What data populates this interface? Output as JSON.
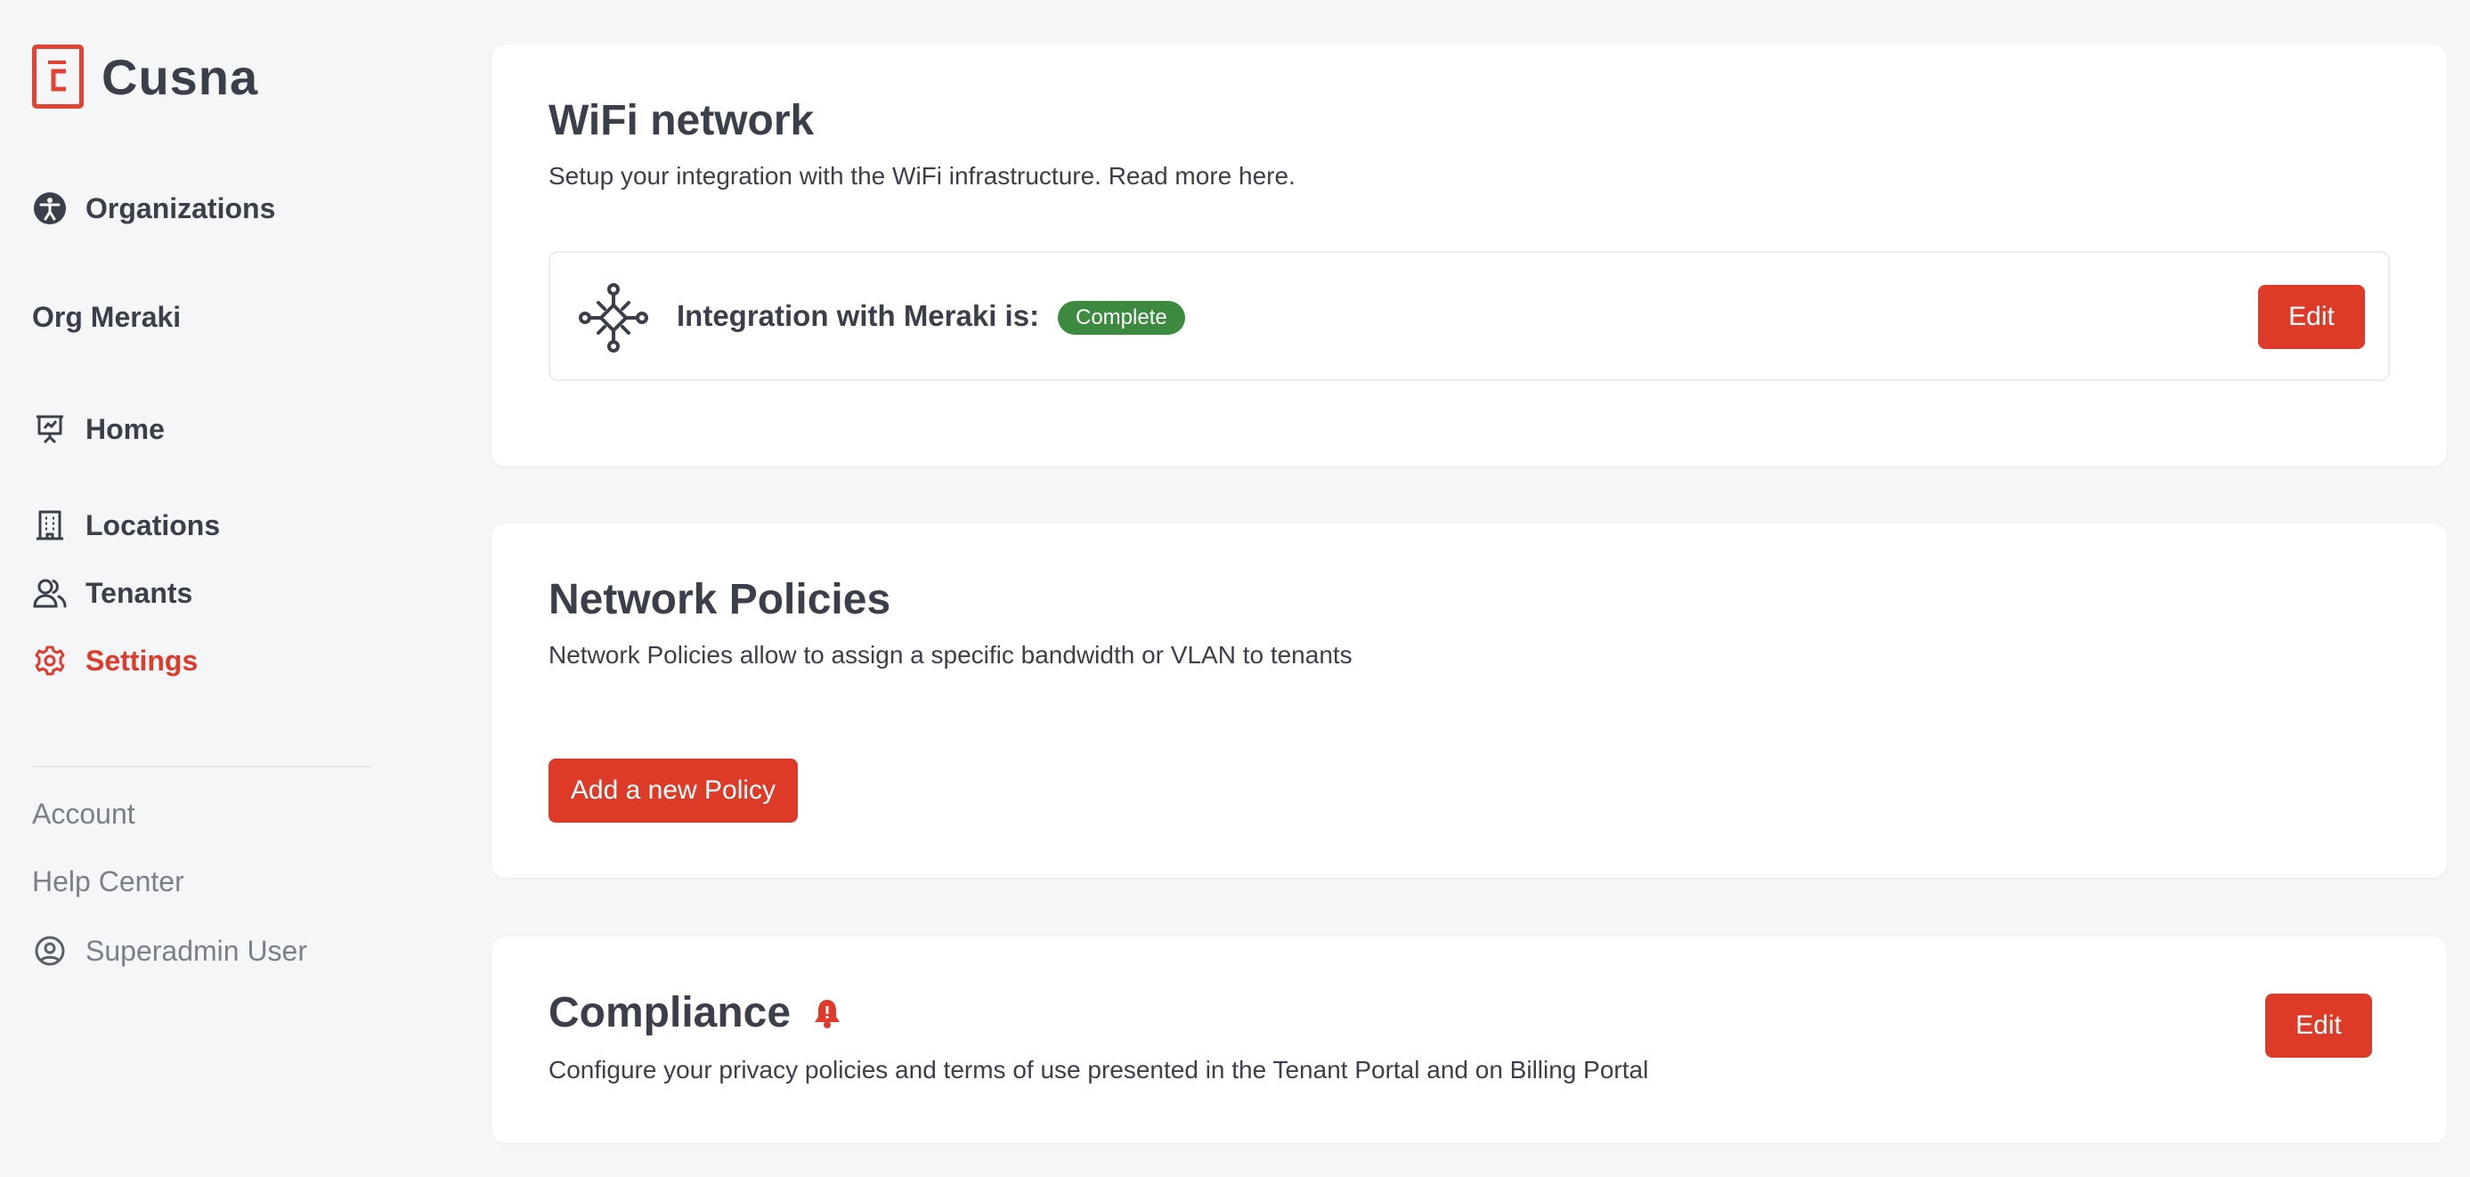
{
  "brand": {
    "name": "Cusna",
    "accent_color": "#e14433"
  },
  "sidebar": {
    "organizations_label": "Organizations",
    "org_name": "Org Meraki",
    "nav": [
      {
        "label": "Home",
        "icon": "presentation-chart-icon"
      },
      {
        "label": "Locations",
        "icon": "building-icon"
      },
      {
        "label": "Tenants",
        "icon": "users-icon"
      },
      {
        "label": "Settings",
        "icon": "gear-icon",
        "active": true
      }
    ],
    "account_label": "Account",
    "help_label": "Help Center",
    "user_label": "Superadmin User"
  },
  "wifi": {
    "title": "WiFi network",
    "description": "Setup your integration with the WiFi infrastructure. Read more here.",
    "integration_label": "Integration with Meraki is:",
    "status": "Complete",
    "status_color": "#3c8a3f",
    "edit_label": "Edit"
  },
  "policies": {
    "title": "Network Policies",
    "description": "Network Policies allow to assign a specific bandwidth or VLAN to tenants",
    "add_label": "Add a new Policy"
  },
  "compliance": {
    "title": "Compliance",
    "description": "Configure your privacy policies and terms of use presented in the Tenant Portal and on Billing Portal",
    "edit_label": "Edit"
  }
}
